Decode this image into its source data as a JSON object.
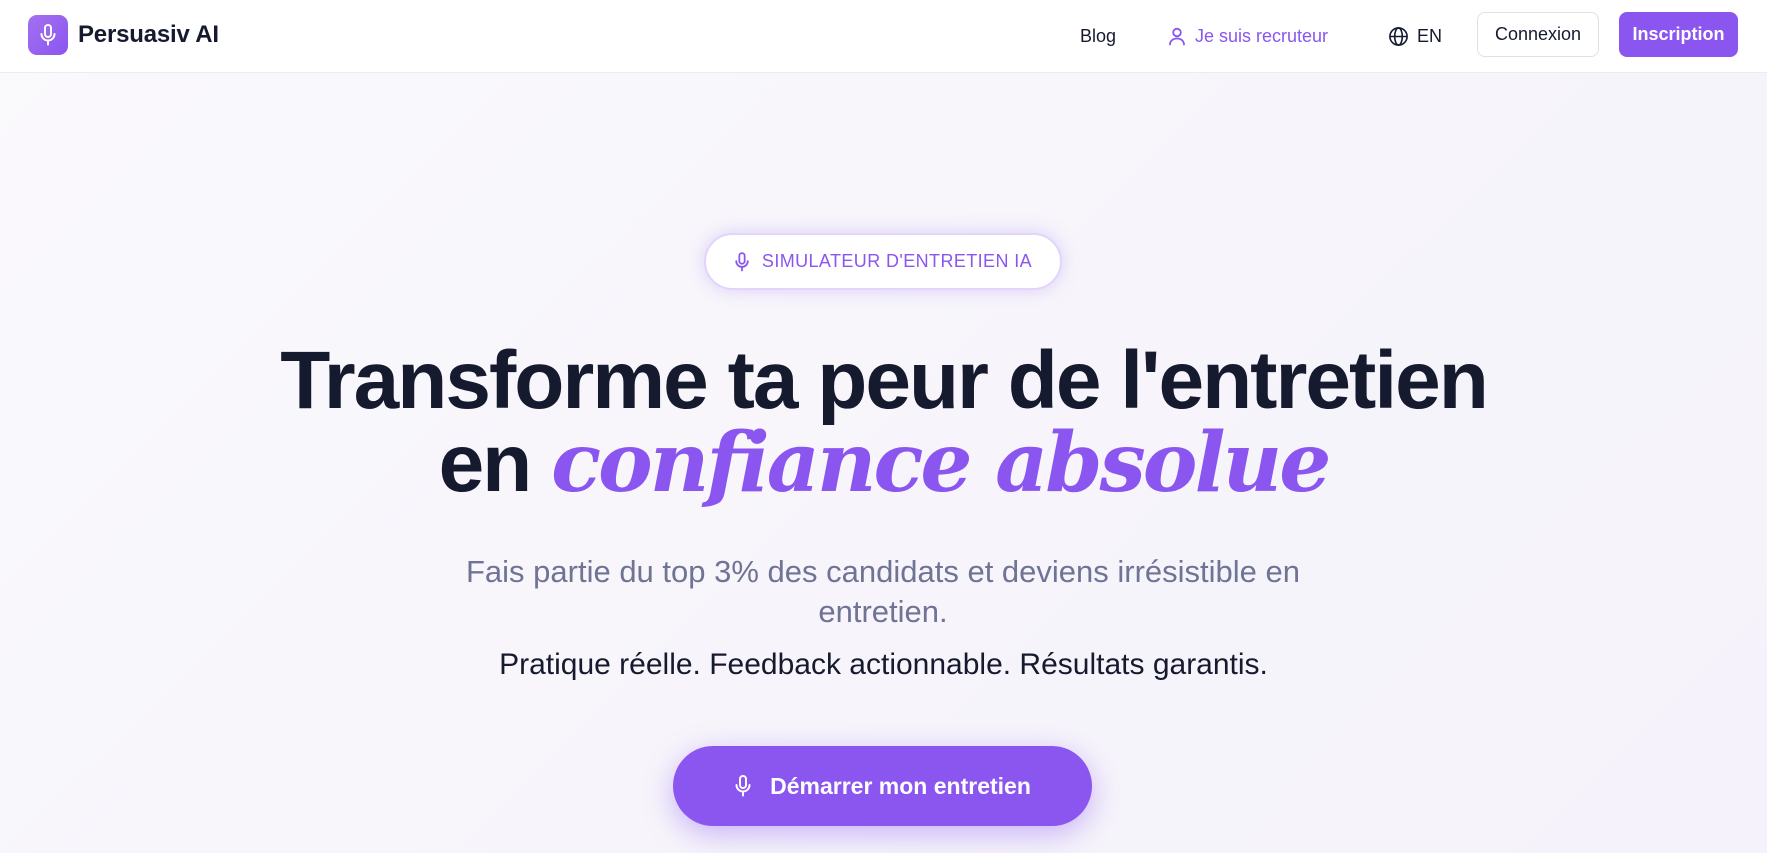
{
  "header": {
    "brand": "Persuasiv AI",
    "nav": {
      "blog": "Blog",
      "recruiter": "Je suis recruteur",
      "language": "EN"
    },
    "login_label": "Connexion",
    "signup_label": "Inscription"
  },
  "hero": {
    "badge": "SIMULATEUR D'ENTRETIEN IA",
    "headline_line1": "Transforme ta peur de l'entretien",
    "headline_line2_prefix": "en",
    "headline_line2_accent": "confiance absolue",
    "subtitle": "Fais partie du top 3% des candidats et deviens irrésistible en entretien.",
    "tagline": "Pratique réelle. Feedback actionnable. Résultats garantis.",
    "cta_label": "Démarrer mon entretien"
  },
  "icons": {
    "logo": "microphone-icon",
    "recruiter": "user-icon",
    "language": "globe-icon",
    "badge": "microphone-icon",
    "cta": "microphone-icon"
  },
  "colors": {
    "accent": "#8b55f0",
    "text_dark": "#161a2e",
    "text_muted": "#6f7394",
    "background": "#f8f6fc"
  }
}
